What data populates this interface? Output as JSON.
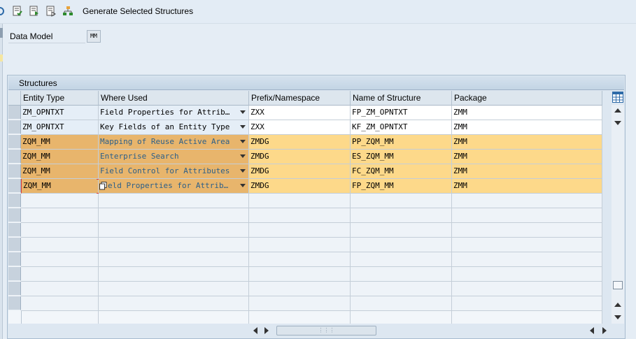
{
  "toolbar": {
    "generate_label": "Generate Selected Structures",
    "icons": [
      "refresh-icon",
      "check-document-icon",
      "execute-document-icon",
      "display-document-icon",
      "hierarchy-icon"
    ]
  },
  "form": {
    "data_model_label": "Data Model",
    "data_model_value": "MM"
  },
  "panel": {
    "title": "Structures"
  },
  "table": {
    "columns": [
      "Entity Type",
      "Where Used",
      "Prefix/Namespace",
      "Name of Structure",
      "Package"
    ],
    "rows": [
      {
        "entity": "ZM_OPNTXT",
        "where": "Field Properties for Attrib…",
        "prefix": "ZXX",
        "name": "FP_ZM_OPNTXT",
        "package": "ZMM",
        "highlight": false
      },
      {
        "entity": "ZM_OPNTXT",
        "where": "Key Fields of an Entity Type",
        "prefix": "ZXX",
        "name": "KF_ZM_OPNTXT",
        "package": "ZMM",
        "highlight": false
      },
      {
        "entity": "ZQM_MM",
        "where": "Mapping of Reuse Active Area",
        "prefix": "ZMDG",
        "name": "PP_ZQM_MM",
        "package": "ZMM",
        "highlight": true
      },
      {
        "entity": "ZQM_MM",
        "where": "Enterprise Search",
        "prefix": "ZMDG",
        "name": "ES_ZQM_MM",
        "package": "ZMM",
        "highlight": true
      },
      {
        "entity": "ZQM_MM",
        "where": "Field Control for Attributes",
        "prefix": "ZMDG",
        "name": "FC_ZQM_MM",
        "package": "ZMM",
        "highlight": true
      },
      {
        "entity": "ZQM_MM",
        "where": "eld Properties for Attrib…",
        "prefix": "ZMDG",
        "name": "FP_ZQM_MM",
        "package": "ZMM",
        "highlight": true
      }
    ]
  },
  "colors": {
    "highlight_row": "#fdd98a",
    "highlight_entity": "#e8b56c",
    "normal_row": "#ffffff",
    "entity_normal": "#e5eef7"
  }
}
